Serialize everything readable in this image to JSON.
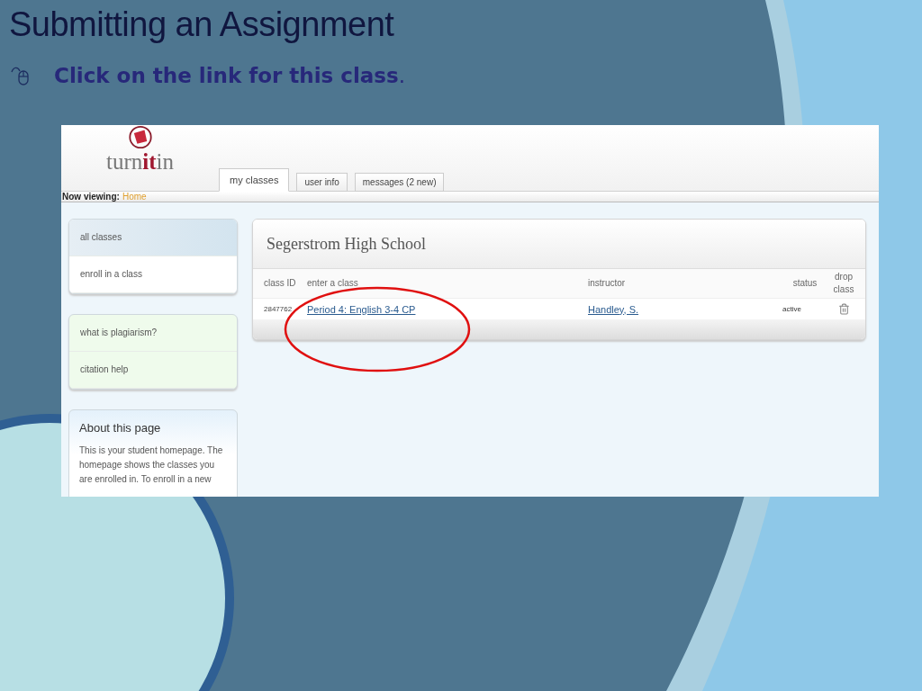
{
  "slide": {
    "title": "Submitting an Assignment",
    "bullets": [
      {
        "text": "**Click on the link for this class**."
      }
    ]
  },
  "screenshot": {
    "logo": [
      {
        "text": "turn",
        "accent": false
      },
      {
        "text": "it",
        "accent": true
      },
      {
        "text": "in",
        "accent": false
      }
    ],
    "tabs": [
      {
        "label": "my classes",
        "selected": true
      },
      {
        "label": "user info",
        "selected": false
      },
      {
        "label": "messages (2 new)",
        "selected": false
      }
    ],
    "breadcrumb": {
      "label": "Now viewing:",
      "link": "Home"
    },
    "menus": [
      {
        "kind": "nav",
        "items": [
          {
            "label": "all classes",
            "selected": true
          },
          {
            "label": "enroll in a class",
            "selected": false
          }
        ]
      },
      {
        "kind": "help",
        "items": [
          {
            "label": "what is plagiarism?",
            "selected": false
          },
          {
            "label": "citation help",
            "selected": false
          }
        ]
      }
    ],
    "about": {
      "title": "About this page",
      "text": "This is your student homepage. The homepage shows the classes you are enrolled in. To enroll in a new"
    },
    "class_card": {
      "school": "Segerstrom High School",
      "columns": [
        "class ID",
        "enter a class",
        "instructor",
        "status",
        "drop class"
      ],
      "rows": [
        {
          "class_id": "2847762",
          "class_name": "Period 4: English 3-4 CP",
          "instructor": "Handley, S.",
          "status": "active"
        }
      ]
    }
  }
}
